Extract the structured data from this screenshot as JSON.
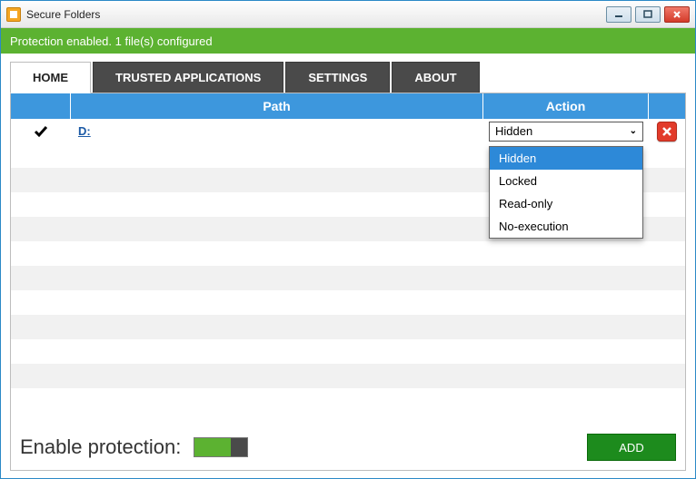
{
  "window": {
    "title": "Secure Folders"
  },
  "status": {
    "text": "Protection enabled. 1 file(s) configured"
  },
  "tabs": {
    "home": "HOME",
    "trusted": "TRUSTED APPLICATIONS",
    "settings": "SETTINGS",
    "about": "ABOUT",
    "active": "home"
  },
  "columns": {
    "path": "Path",
    "action": "Action"
  },
  "rows": [
    {
      "checked": true,
      "path": "D:",
      "action": "Hidden"
    }
  ],
  "action_options": [
    "Hidden",
    "Locked",
    "Read-only",
    "No-execution"
  ],
  "action_selected": "Hidden",
  "footer": {
    "label": "Enable protection:",
    "enabled": true,
    "add": "ADD"
  }
}
